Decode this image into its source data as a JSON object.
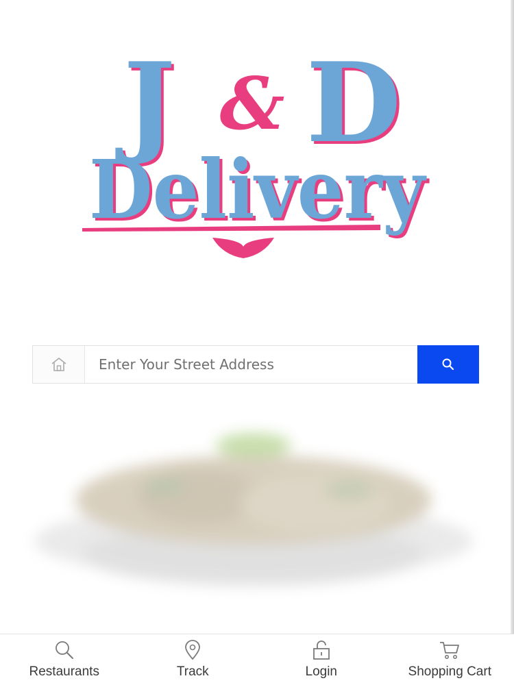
{
  "brand": {
    "line1_left": "J",
    "line1_amp": "&",
    "line1_right": "D",
    "line2": "Delivery",
    "colors": {
      "primary": "#6ba6d6",
      "accent": "#e83e7f"
    }
  },
  "search": {
    "placeholder": "Enter Your Street Address",
    "home_icon": "home-icon",
    "button_icon": "search-icon",
    "button_color": "#0a49f0"
  },
  "hero": {
    "image_icon": "food-plate-image"
  },
  "bottom_nav": {
    "items": [
      {
        "label": "Restaurants",
        "icon": "search-icon"
      },
      {
        "label": "Track",
        "icon": "map-pin-icon"
      },
      {
        "label": "Login",
        "icon": "lock-icon"
      },
      {
        "label": "Shopping Cart",
        "icon": "cart-icon"
      }
    ]
  }
}
